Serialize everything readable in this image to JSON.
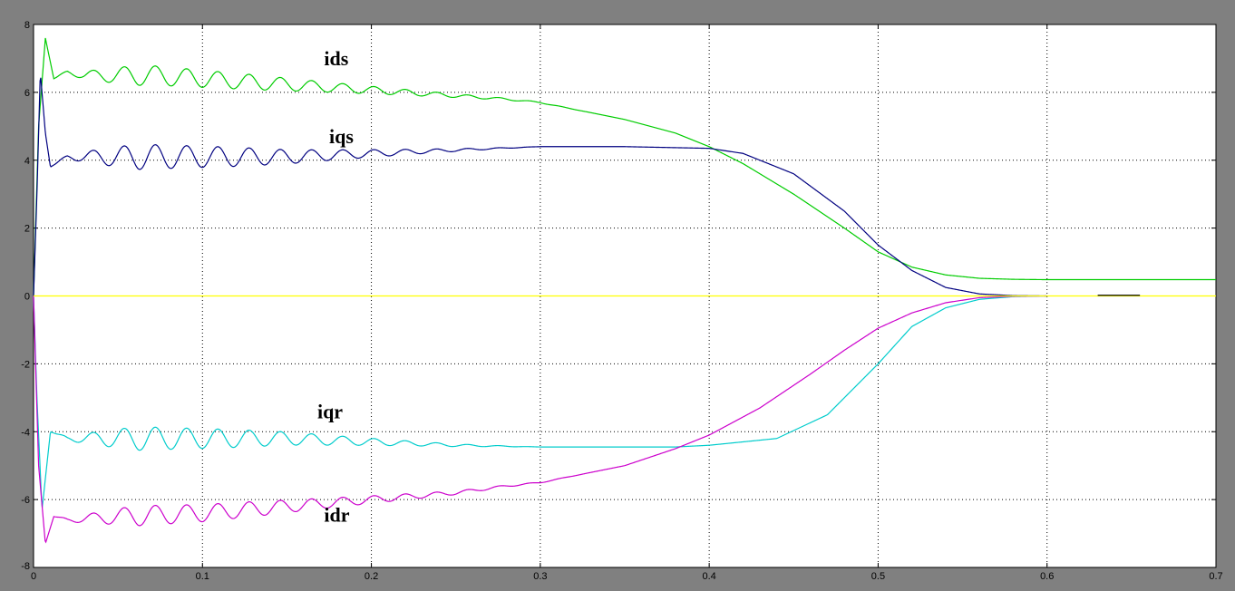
{
  "chart_data": {
    "type": "line",
    "title": "",
    "xlabel": "",
    "ylabel": "",
    "xlim": [
      0,
      0.7
    ],
    "ylim": [
      -8,
      8
    ],
    "xticks": [
      0,
      0.1,
      0.2,
      0.3,
      0.4,
      0.5,
      0.6,
      0.7
    ],
    "yticks": [
      8,
      6,
      4,
      2,
      0,
      -2,
      -4,
      -6,
      -8
    ],
    "xtick_labels": [
      "0",
      "0.1",
      "0.2",
      "0.3",
      "0.4",
      "0.5",
      "0.6",
      "0.7"
    ],
    "ytick_labels": [
      "8",
      "6",
      "4",
      "2",
      "0",
      "-2",
      "-4",
      "-6",
      "-8"
    ],
    "grid": true,
    "background": "#ffffff",
    "figure_background": "#808080",
    "series": [
      {
        "name": "ids",
        "color": "#00cc00",
        "x": [
          0,
          0.003,
          0.007,
          0.012,
          0.02,
          0.03,
          0.05,
          0.07,
          0.1,
          0.13,
          0.16,
          0.19,
          0.22,
          0.25,
          0.28,
          0.3,
          0.32,
          0.35,
          0.38,
          0.4,
          0.42,
          0.45,
          0.48,
          0.5,
          0.52,
          0.54,
          0.56,
          0.58,
          0.6,
          0.65,
          0.7
        ],
        "y": [
          0,
          5.0,
          7.6,
          6.4,
          6.6,
          6.5,
          6.5,
          6.5,
          6.4,
          6.3,
          6.2,
          6.1,
          6.0,
          5.9,
          5.8,
          5.7,
          5.5,
          5.2,
          4.8,
          4.4,
          3.9,
          3.0,
          2.0,
          1.3,
          0.85,
          0.62,
          0.52,
          0.49,
          0.48,
          0.48,
          0.48
        ],
        "oscillation": {
          "amplitude": 0.35,
          "period": 0.0185,
          "decay_end": 0.33
        }
      },
      {
        "name": "iqs",
        "color": "#000080",
        "x": [
          0,
          0.002,
          0.004,
          0.007,
          0.01,
          0.02,
          0.05,
          0.1,
          0.15,
          0.2,
          0.25,
          0.3,
          0.35,
          0.4,
          0.42,
          0.45,
          0.48,
          0.5,
          0.52,
          0.54,
          0.56,
          0.58,
          0.6
        ],
        "y": [
          0,
          3.0,
          6.6,
          4.8,
          3.8,
          4.1,
          4.1,
          4.1,
          4.1,
          4.2,
          4.3,
          4.4,
          4.4,
          4.35,
          4.2,
          3.6,
          2.5,
          1.5,
          0.75,
          0.25,
          0.06,
          0.01,
          0
        ],
        "oscillation": {
          "amplitude": 0.45,
          "period": 0.0185,
          "decay_end": 0.3
        }
      },
      {
        "name": "iqr",
        "color": "#00cccc",
        "x": [
          0,
          0.002,
          0.005,
          0.01,
          0.02,
          0.05,
          0.1,
          0.15,
          0.2,
          0.25,
          0.3,
          0.35,
          0.38,
          0.4,
          0.44,
          0.47,
          0.5,
          0.52,
          0.54,
          0.56,
          0.58,
          0.6
        ],
        "y": [
          0,
          -3.0,
          -6.3,
          -4.0,
          -4.2,
          -4.2,
          -4.2,
          -4.2,
          -4.3,
          -4.4,
          -4.45,
          -4.45,
          -4.45,
          -4.4,
          -4.2,
          -3.5,
          -2.0,
          -0.9,
          -0.35,
          -0.1,
          -0.02,
          0
        ],
        "oscillation": {
          "amplitude": 0.42,
          "period": 0.0185,
          "decay_end": 0.3
        }
      },
      {
        "name": "idr",
        "color": "#cc00cc",
        "x": [
          0,
          0.003,
          0.007,
          0.012,
          0.02,
          0.05,
          0.1,
          0.15,
          0.2,
          0.25,
          0.28,
          0.3,
          0.32,
          0.35,
          0.38,
          0.4,
          0.43,
          0.46,
          0.48,
          0.5,
          0.52,
          0.54,
          0.56,
          0.58,
          0.6
        ],
        "y": [
          0,
          -5.0,
          -7.3,
          -6.5,
          -6.6,
          -6.5,
          -6.4,
          -6.2,
          -6.0,
          -5.8,
          -5.6,
          -5.5,
          -5.3,
          -5.0,
          -4.5,
          -4.1,
          -3.3,
          -2.3,
          -1.6,
          -0.95,
          -0.5,
          -0.2,
          -0.05,
          -0.01,
          0
        ],
        "oscillation": {
          "amplitude": 0.35,
          "period": 0.0185,
          "decay_end": 0.33
        }
      },
      {
        "name": "",
        "color": "#ffff00",
        "x": [
          0,
          0.7
        ],
        "y": [
          0,
          0
        ]
      },
      {
        "name": "",
        "color": "#000000",
        "x": [
          0.63,
          0.655
        ],
        "y": [
          0.02,
          0.02
        ]
      }
    ],
    "annotations": [
      {
        "text": "ids",
        "x": 0.172,
        "y": 6.8
      },
      {
        "text": "iqs",
        "x": 0.175,
        "y": 4.5
      },
      {
        "text": "iqr",
        "x": 0.168,
        "y": -3.6
      },
      {
        "text": "idr",
        "x": 0.172,
        "y": -6.65
      }
    ]
  }
}
